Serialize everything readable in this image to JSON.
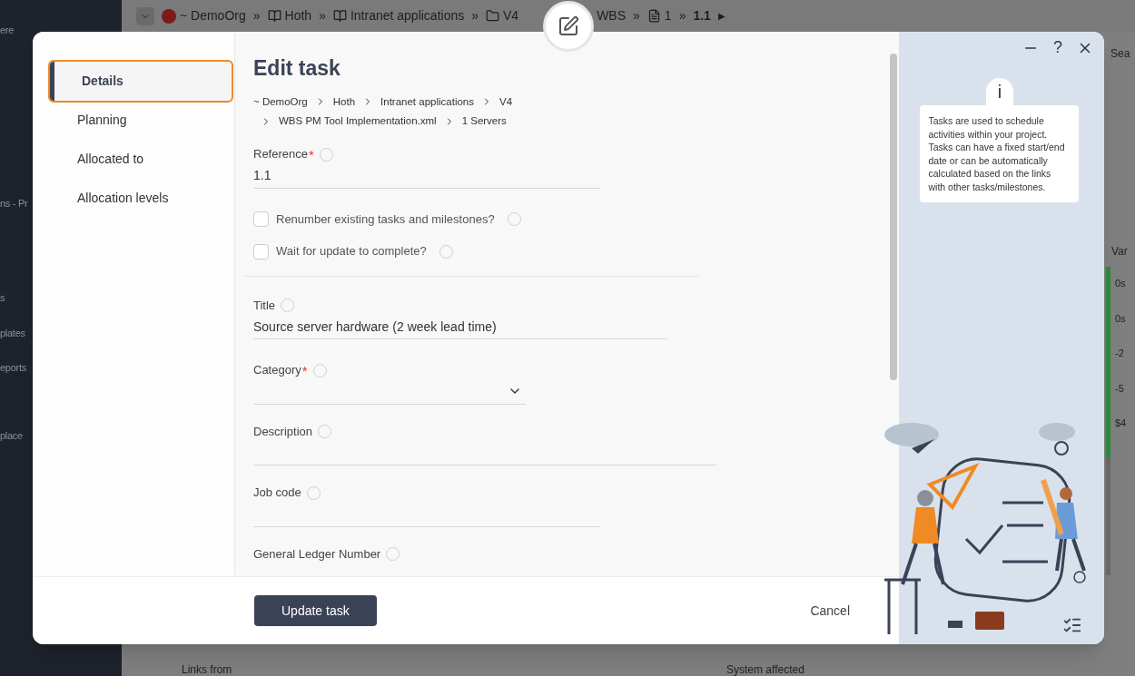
{
  "background": {
    "breadcrumb": [
      {
        "kind": "toggle"
      },
      {
        "kind": "org",
        "label": "~ DemoOrg"
      },
      {
        "kind": "sep",
        "label": "»"
      },
      {
        "kind": "book",
        "label": "Hoth"
      },
      {
        "kind": "sep",
        "label": "»"
      },
      {
        "kind": "book",
        "label": "Intranet applications"
      },
      {
        "kind": "sep",
        "label": "»"
      },
      {
        "kind": "folder",
        "label": "V4"
      },
      {
        "kind": "plain",
        "label": "WBS"
      },
      {
        "kind": "sep",
        "label": "»"
      },
      {
        "kind": "doc",
        "label": "1"
      },
      {
        "kind": "sep",
        "label": "»"
      },
      {
        "kind": "current",
        "label": "1.1"
      },
      {
        "kind": "more",
        "label": "▶"
      }
    ],
    "sidebar_fragments": [
      "ere",
      "ns - Pr",
      "s",
      "plates",
      "eports",
      "place"
    ],
    "search_fragment": "Sea",
    "column_header": "Var",
    "cells": [
      "0s",
      "0s",
      "-2",
      "-5",
      "$4"
    ],
    "panels": [
      "Links from",
      "System affected"
    ]
  },
  "dialog": {
    "title": "Edit task",
    "window_help": "?",
    "nav": [
      {
        "label": "Details",
        "selected": true
      },
      {
        "label": "Planning",
        "selected": false
      },
      {
        "label": "Allocated to",
        "selected": false
      },
      {
        "label": "Allocation levels",
        "selected": false
      }
    ],
    "path": [
      "~ DemoOrg",
      "Hoth",
      "Intranet applications",
      "V4",
      "WBS PM Tool Implementation.xml",
      "1 Servers"
    ],
    "required_mark": "*",
    "sections": [
      [
        {
          "kind": "text",
          "label": "Reference",
          "required": true,
          "value": "1.1"
        },
        {
          "kind": "checkbox",
          "label": "Renumber existing tasks and milestones?",
          "checked": false
        },
        {
          "kind": "checkbox",
          "label": "Wait for update to complete?",
          "checked": false
        }
      ],
      [
        {
          "kind": "text",
          "label": "Title",
          "value": "Source server hardware (2 week lead time)"
        },
        {
          "kind": "select",
          "label": "Category",
          "required": true
        },
        {
          "kind": "text",
          "label": "Description"
        },
        {
          "kind": "text",
          "label": "Job code"
        },
        {
          "kind": "text",
          "label": "General Ledger Number"
        }
      ]
    ],
    "info_glyph": "i",
    "info": "Tasks are used to schedule activities within your project. Tasks can have a fixed start/end date or can be automatically calculated based on the links with other tasks/milestones.",
    "primary_button": "Update task",
    "cancel_button": "Cancel"
  }
}
